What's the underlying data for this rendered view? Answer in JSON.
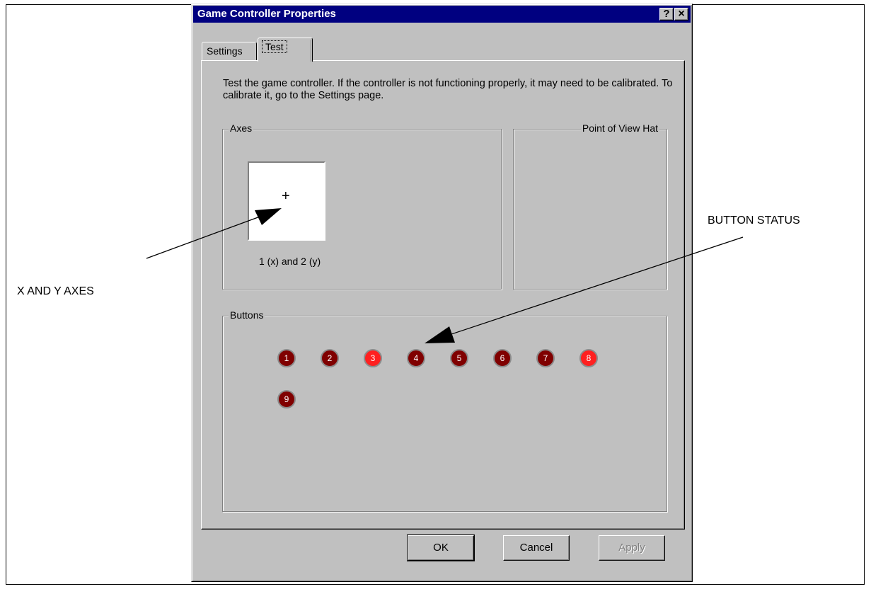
{
  "dialog": {
    "title": "Game Controller Properties",
    "help_label": "?",
    "close_label": "×"
  },
  "tabs": [
    {
      "label": "Settings",
      "active": false
    },
    {
      "label": "Test",
      "active": true
    }
  ],
  "test_page": {
    "description": "Test the game controller.  If the controller is not functioning properly, it may need to be calibrated.  To calibrate it, go to the Settings page.",
    "axes_group": {
      "label": "Axes",
      "crosshair": "+",
      "caption": "1 (x) and 2 (y)"
    },
    "pov_group": {
      "label": "Point of View Hat"
    },
    "buttons_group": {
      "label": "Buttons",
      "buttons": [
        {
          "label": "1",
          "pressed": false
        },
        {
          "label": "2",
          "pressed": false
        },
        {
          "label": "3",
          "pressed": true
        },
        {
          "label": "4",
          "pressed": false
        },
        {
          "label": "5",
          "pressed": false
        },
        {
          "label": "6",
          "pressed": false
        },
        {
          "label": "7",
          "pressed": false
        },
        {
          "label": "8",
          "pressed": true
        },
        {
          "label": "9",
          "pressed": false
        }
      ]
    }
  },
  "footer": {
    "ok_label": "OK",
    "cancel_label": "Cancel",
    "apply_label": "Apply"
  },
  "annotations": {
    "xy_axes": "X AND Y AXES",
    "button_status": "BUTTON STATUS"
  },
  "colors": {
    "titlebar": "#000080",
    "dialog_bg": "#c0c0c0",
    "button_pressed": "#ff2020",
    "button_released": "#800000"
  }
}
